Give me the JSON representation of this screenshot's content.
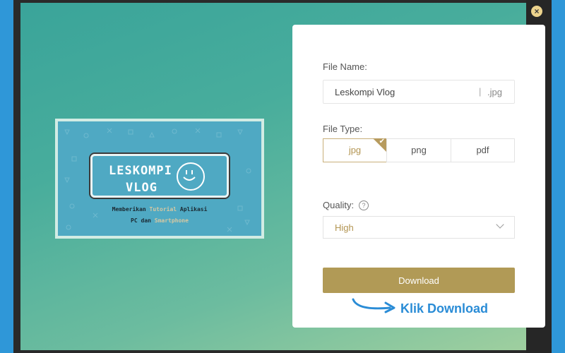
{
  "close_symbol": "×",
  "thumbnail": {
    "title_line1": "LESKOMPI",
    "title_line2": "VLOG",
    "tagline_part1": "Memberikan ",
    "tagline_highlight": "Tutorial",
    "tagline_part2": " Aplikasi",
    "tagline2_part1": "PC dan ",
    "tagline2_highlight": "Smartphone"
  },
  "panel": {
    "file_name_label": "File Name:",
    "file_name_value": "Leskompi Vlog",
    "separator": "|",
    "file_ext": ".jpg",
    "file_type_label": "File Type:",
    "file_types": [
      "jpg",
      "png",
      "pdf"
    ],
    "selected_type": "jpg",
    "check_symbol": "✔",
    "quality_label": "Quality:",
    "help_symbol": "?",
    "quality_value": "High",
    "download_label": "Download"
  },
  "annotation": {
    "text": "Klik Download",
    "color": "#2a8cd6"
  },
  "colors": {
    "accent": "#b19a56",
    "background": "#2f97d8"
  }
}
